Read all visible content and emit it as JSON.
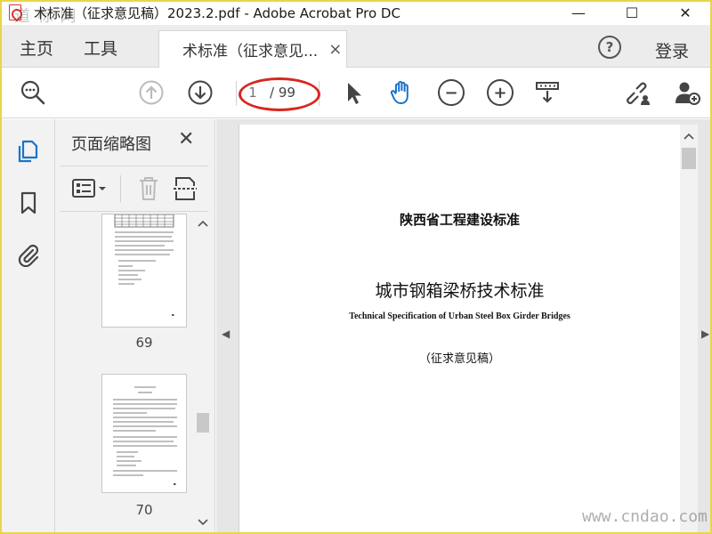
{
  "window": {
    "title": "术标准（征求意见稿）2023.2.pdf - Adobe Acrobat Pro DC",
    "watermark": "道 标 网",
    "minimize": "—",
    "maximize": "☐",
    "close": "✕"
  },
  "menubar": {
    "home": "主页",
    "tools": "工具",
    "tab_label": "术标准（征求意见...",
    "tab_close": "×",
    "help": "?",
    "login": "登录"
  },
  "toolbar": {
    "current_page": "1",
    "total_pages": "/ 99",
    "accent": "#1a73c8",
    "annotation_color": "#d8261f"
  },
  "panel": {
    "title": "页面缩略图",
    "close": "✕",
    "thumbnails": [
      {
        "label": "69"
      },
      {
        "label": "70"
      }
    ]
  },
  "document": {
    "org": "陕西省工程建设标准",
    "title": "城市钢箱梁桥技术标准",
    "english_title": "Technical Specification of Urban Steel Box Girder Bridges",
    "draft": "（征求意见稿）"
  },
  "site_watermark": "www.cndao.com"
}
